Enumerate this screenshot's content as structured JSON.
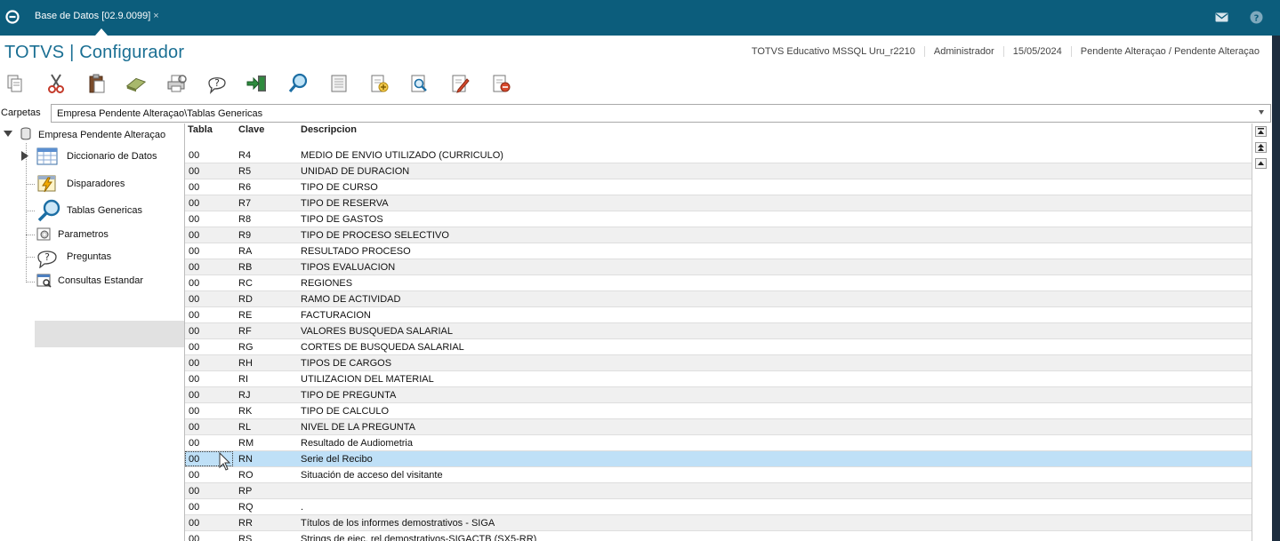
{
  "window": {
    "tab_title": "Base de Datos [02.9.0099]",
    "tab_close": "×",
    "icons": {
      "logo": "totvs-logo-icon",
      "mail": "mail-icon",
      "help": "help-icon"
    },
    "colors": {
      "topbar": "#0c5d7c",
      "brand": "#1a6f93",
      "selected_row": "#bfe0f7"
    }
  },
  "header": {
    "title": "TOTVS | Configurador",
    "status": [
      "TOTVS Educativo MSSQL Uru_r2210",
      "Administrador",
      "15/05/2024",
      "Pendente Alteraçao / Pendente Alteraçao"
    ]
  },
  "toolbar": {
    "buttons": [
      "copy-icon",
      "cut-icon",
      "paste-icon",
      "eraser-icon",
      "print-icon",
      "help-icon",
      "exit-icon",
      "search-icon",
      "view-icon",
      "add-icon",
      "preview-icon",
      "edit-icon",
      "delete-icon"
    ]
  },
  "folders": {
    "label": "Carpetas",
    "path": "Empresa Pendente Alteraçao\\Tablas Genericas"
  },
  "tree": {
    "root": "Empresa Pendente Alteraçao",
    "items": [
      {
        "label": "Diccionario de Datos",
        "icon": "table-icon"
      },
      {
        "label": "Disparadores",
        "icon": "trigger-icon"
      },
      {
        "label": "Tablas Genericas",
        "icon": "magnifier-icon"
      },
      {
        "label": "Parametros",
        "icon": "parameters-icon"
      },
      {
        "label": "Preguntas",
        "icon": "question-icon"
      },
      {
        "label": "Consultas Estandar",
        "icon": "query-icon"
      }
    ],
    "selected": "Tablas Genericas"
  },
  "grid": {
    "columns": [
      "Tabla",
      "Clave",
      "Descripcion"
    ],
    "rows": [
      {
        "tabla": "00",
        "clave": "R4",
        "desc": "MEDIO DE ENVIO UTILIZADO (CURRICULO)"
      },
      {
        "tabla": "00",
        "clave": "R5",
        "desc": "UNIDAD DE DURACION"
      },
      {
        "tabla": "00",
        "clave": "R6",
        "desc": "TIPO DE CURSO"
      },
      {
        "tabla": "00",
        "clave": "R7",
        "desc": "TIPO DE RESERVA"
      },
      {
        "tabla": "00",
        "clave": "R8",
        "desc": "TIPO DE GASTOS"
      },
      {
        "tabla": "00",
        "clave": "R9",
        "desc": "TIPO DE PROCESO SELECTIVO"
      },
      {
        "tabla": "00",
        "clave": "RA",
        "desc": "RESULTADO PROCESO"
      },
      {
        "tabla": "00",
        "clave": "RB",
        "desc": "TIPOS EVALUACION"
      },
      {
        "tabla": "00",
        "clave": "RC",
        "desc": "REGIONES"
      },
      {
        "tabla": "00",
        "clave": "RD",
        "desc": "RAMO DE ACTIVIDAD"
      },
      {
        "tabla": "00",
        "clave": "RE",
        "desc": "FACTURACION"
      },
      {
        "tabla": "00",
        "clave": "RF",
        "desc": "VALORES BUSQUEDA SALARIAL"
      },
      {
        "tabla": "00",
        "clave": "RG",
        "desc": "CORTES DE BUSQUEDA SALARIAL"
      },
      {
        "tabla": "00",
        "clave": "RH",
        "desc": "TIPOS DE CARGOS"
      },
      {
        "tabla": "00",
        "clave": "RI",
        "desc": "UTILIZACION DEL MATERIAL"
      },
      {
        "tabla": "00",
        "clave": "RJ",
        "desc": "TIPO DE PREGUNTA"
      },
      {
        "tabla": "00",
        "clave": "RK",
        "desc": "TIPO DE CALCULO"
      },
      {
        "tabla": "00",
        "clave": "RL",
        "desc": "NIVEL DE LA PREGUNTA"
      },
      {
        "tabla": "00",
        "clave": "RM",
        "desc": "Resultado de Audiometria"
      },
      {
        "tabla": "00",
        "clave": "RN",
        "desc": "Serie del Recibo"
      },
      {
        "tabla": "00",
        "clave": "RO",
        "desc": "Situación de acceso del visitante"
      },
      {
        "tabla": "00",
        "clave": "RP",
        "desc": ""
      },
      {
        "tabla": "00",
        "clave": "RQ",
        "desc": "."
      },
      {
        "tabla": "00",
        "clave": "RR",
        "desc": "Títulos de los informes demostrativos - SIGA"
      },
      {
        "tabla": "00",
        "clave": "RS",
        "desc": "Strings de ejec. rel.demostrativos-SIGACTB (SX5-RR)"
      }
    ],
    "selected_index": 19
  }
}
